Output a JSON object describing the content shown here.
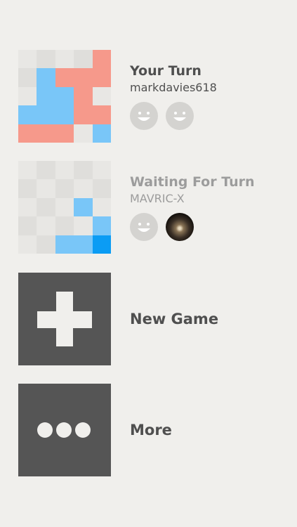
{
  "colors": {
    "background": "#f0efec",
    "red": "#f6998b",
    "blue": "#79c6f8",
    "blue_dark": "#0b9cf4",
    "empty_light": "#e8e7e4",
    "empty_dark": "#dfdedb",
    "tile": "#555555",
    "avatar_gray": "#d4d3d0"
  },
  "games": [
    {
      "title": "Your Turn",
      "opponent": "markdavies618",
      "board": [
        [
          "L",
          "D",
          "L",
          "D",
          "R"
        ],
        [
          "D",
          "B",
          "R",
          "R",
          "R"
        ],
        [
          "L",
          "B",
          "B",
          "R",
          "L"
        ],
        [
          "B",
          "B",
          "B",
          "R",
          "R"
        ],
        [
          "R",
          "R",
          "R",
          "L",
          "B"
        ]
      ],
      "avatars": [
        "smiley-avatar-icon",
        "smiley-avatar-icon"
      ]
    },
    {
      "title": "Waiting For Turn",
      "opponent": "MAVRIC-X",
      "board": [
        [
          "L",
          "D",
          "L",
          "D",
          "L"
        ],
        [
          "D",
          "L",
          "D",
          "L",
          "D"
        ],
        [
          "L",
          "D",
          "L",
          "B",
          "L"
        ],
        [
          "D",
          "L",
          "D",
          "L",
          "B"
        ],
        [
          "L",
          "D",
          "B",
          "B",
          "K"
        ]
      ],
      "avatars": [
        "smiley-avatar-icon",
        "photo-avatar-icon"
      ]
    }
  ],
  "new_game": {
    "label": "New Game",
    "icon": "plus-icon"
  },
  "more": {
    "label": "More",
    "icon": "ellipsis-icon"
  }
}
